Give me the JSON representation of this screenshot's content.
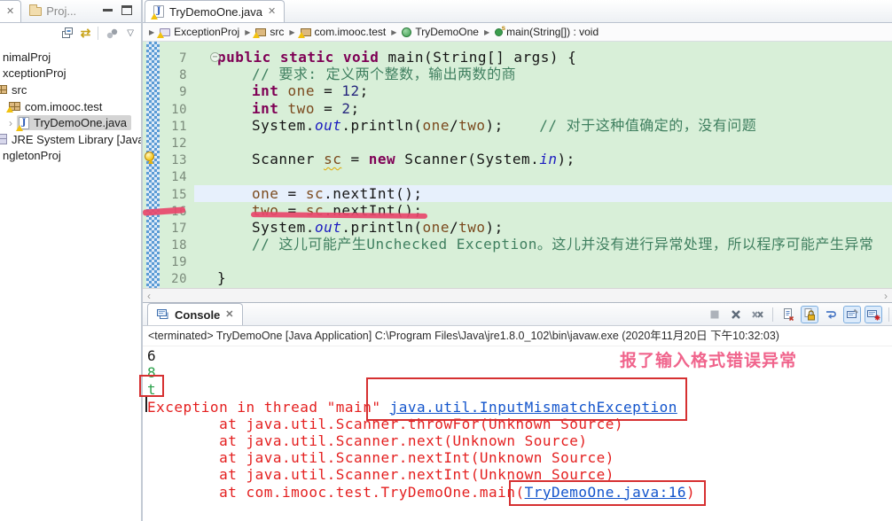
{
  "icons": {
    "close": "✕",
    "dropdown": "▽",
    "link_editor": "⇄",
    "arrow": "▶",
    "expander": "›",
    "fold_minus": "−",
    "hscroll_left": "‹",
    "hscroll_right": "›",
    "java_glyph": "J"
  },
  "explorer": {
    "projects_tab_label": "Proj...",
    "toolbar_icons": [
      "collapse-all",
      "link-with-editor",
      "focus-view",
      "view-menu-dropdown"
    ],
    "tree": [
      {
        "label": "nimalProj"
      },
      {
        "label": "xceptionProj"
      },
      {
        "label": "src",
        "icon": "package-root",
        "cut": true
      },
      {
        "label": "com.imooc.test",
        "icon": "package",
        "warn": true
      },
      {
        "label": "TryDemoOne.java",
        "icon": "java-file",
        "warn": true,
        "expander": true,
        "selected": true
      },
      {
        "label": "JRE System Library [JavaS",
        "icon": "library",
        "cut": true
      },
      {
        "label": "ngletonProj"
      }
    ]
  },
  "editor": {
    "tab_label": "TryDemoOne.java",
    "breadcrumb": [
      {
        "label": "ExceptionProj",
        "icon": "project"
      },
      {
        "label": "src",
        "icon": "package-root"
      },
      {
        "label": "com.imooc.test",
        "icon": "package"
      },
      {
        "label": "TryDemoOne",
        "icon": "class"
      },
      {
        "label": "main(String[]) : void",
        "icon": "method"
      }
    ],
    "lines": [
      {
        "num": "7",
        "indent": 1,
        "fold": true,
        "seg": [
          {
            "c": "k",
            "t": "public static void"
          },
          {
            "c": "p",
            "t": " main(String[] args) {"
          }
        ]
      },
      {
        "num": "8",
        "indent": 2,
        "seg": [
          {
            "c": "c",
            "t": "// 要求: 定义两个整数，输出两数的商"
          }
        ]
      },
      {
        "num": "9",
        "indent": 2,
        "seg": [
          {
            "c": "k",
            "t": "int"
          },
          {
            "c": "p",
            "t": " "
          },
          {
            "c": "v",
            "t": "one"
          },
          {
            "c": "p",
            "t": " = "
          },
          {
            "c": "n",
            "t": "12"
          },
          {
            "c": "p",
            "t": ";"
          }
        ]
      },
      {
        "num": "10",
        "indent": 2,
        "seg": [
          {
            "c": "k",
            "t": "int"
          },
          {
            "c": "p",
            "t": " "
          },
          {
            "c": "v",
            "t": "two"
          },
          {
            "c": "p",
            "t": " = "
          },
          {
            "c": "n",
            "t": "2"
          },
          {
            "c": "p",
            "t": ";"
          }
        ]
      },
      {
        "num": "11",
        "indent": 2,
        "seg": [
          {
            "c": "p",
            "t": "System."
          },
          {
            "c": "f",
            "t": "out"
          },
          {
            "c": "p",
            "t": ".println("
          },
          {
            "c": "v",
            "t": "one"
          },
          {
            "c": "p",
            "t": "/"
          },
          {
            "c": "v",
            "t": "two"
          },
          {
            "c": "p",
            "t": ");    "
          },
          {
            "c": "c",
            "t": "// 对于这种值确定的，没有问题"
          }
        ]
      },
      {
        "num": "12",
        "indent": 2,
        "seg": []
      },
      {
        "num": "13",
        "indent": 2,
        "seg": [
          {
            "c": "p",
            "t": "Scanner "
          },
          {
            "c": "vw",
            "t": "sc"
          },
          {
            "c": "p",
            "t": " = "
          },
          {
            "c": "k",
            "t": "new"
          },
          {
            "c": "p",
            "t": " Scanner(System."
          },
          {
            "c": "f",
            "t": "in"
          },
          {
            "c": "p",
            "t": ");"
          }
        ]
      },
      {
        "num": "14",
        "indent": 2,
        "seg": []
      },
      {
        "num": "15",
        "indent": 2,
        "highlight": true,
        "seg": [
          {
            "c": "v",
            "t": "one"
          },
          {
            "c": "p",
            "t": " = "
          },
          {
            "c": "v",
            "t": "sc"
          },
          {
            "c": "p",
            "t": ".nextInt();"
          }
        ]
      },
      {
        "num": "16",
        "indent": 2,
        "seg": [
          {
            "c": "v",
            "t": "two"
          },
          {
            "c": "p",
            "t": " = "
          },
          {
            "c": "v",
            "t": "sc"
          },
          {
            "c": "p",
            "t": ".nextInt();"
          }
        ]
      },
      {
        "num": "17",
        "indent": 2,
        "seg": [
          {
            "c": "p",
            "t": "System."
          },
          {
            "c": "f",
            "t": "out"
          },
          {
            "c": "p",
            "t": ".println("
          },
          {
            "c": "v",
            "t": "one"
          },
          {
            "c": "p",
            "t": "/"
          },
          {
            "c": "v",
            "t": "two"
          },
          {
            "c": "p",
            "t": ");"
          }
        ]
      },
      {
        "num": "18",
        "indent": 2,
        "seg": [
          {
            "c": "c",
            "t": "// 这儿可能产生Unchecked Exception。这儿并没有进行异常处理，所以程序可能产生异常"
          }
        ]
      },
      {
        "num": "19",
        "indent": 2,
        "seg": []
      },
      {
        "num": "20",
        "indent": 1,
        "seg": [
          {
            "c": "p",
            "t": "}"
          }
        ]
      }
    ]
  },
  "console": {
    "tab_label": "Console",
    "status": "<terminated> TryDemoOne [Java Application] C:\\Program Files\\Java\\jre1.8.0_102\\bin\\javaw.exe (2020年11月20日 下午10:32:03)",
    "toolbar_icons": [
      "terminate",
      "remove-launch",
      "remove-all-terminated",
      "clear-console",
      "scroll-lock",
      "word-wrap",
      "pin-console",
      "show-console-on-output"
    ],
    "lines": [
      {
        "seg": [
          {
            "c": "out",
            "t": "6"
          }
        ]
      },
      {
        "seg": [
          {
            "c": "in",
            "t": "8"
          }
        ]
      },
      {
        "seg": [
          {
            "c": "in",
            "t": "t"
          }
        ]
      },
      {
        "seg": [
          {
            "c": "err",
            "t": "Exception in thread \"main\" "
          },
          {
            "c": "link",
            "t": "java.util.InputMismatchException"
          }
        ]
      },
      {
        "seg": [
          {
            "c": "err",
            "t": "        at java.util.Scanner.throwFor(Unknown Source)"
          }
        ]
      },
      {
        "seg": [
          {
            "c": "err",
            "t": "        at java.util.Scanner.next(Unknown Source)"
          }
        ]
      },
      {
        "seg": [
          {
            "c": "err",
            "t": "        at java.util.Scanner.nextInt(Unknown Source)"
          }
        ]
      },
      {
        "seg": [
          {
            "c": "err",
            "t": "        at java.util.Scanner.nextInt(Unknown Source)"
          }
        ]
      },
      {
        "seg": [
          {
            "c": "err",
            "t": "        at com.imooc.test.TryDemoOne.main("
          },
          {
            "c": "link",
            "t": "TryDemoOne.java:16"
          },
          {
            "c": "err",
            "t": ")"
          }
        ]
      }
    ]
  },
  "annotations": {
    "note_text": "报了输入格式错误异常"
  },
  "colors": {
    "editor_bg": "#d8efd8",
    "current_line": "#e7f0fc",
    "keyword": "#7f0055",
    "comment": "#3f7f5f",
    "stderr": "#e41f1f",
    "stdin": "#2ba14b",
    "hyperlink": "#1254cc",
    "annotation_marker": "#e8476b",
    "annotation_box": "#d63031"
  }
}
